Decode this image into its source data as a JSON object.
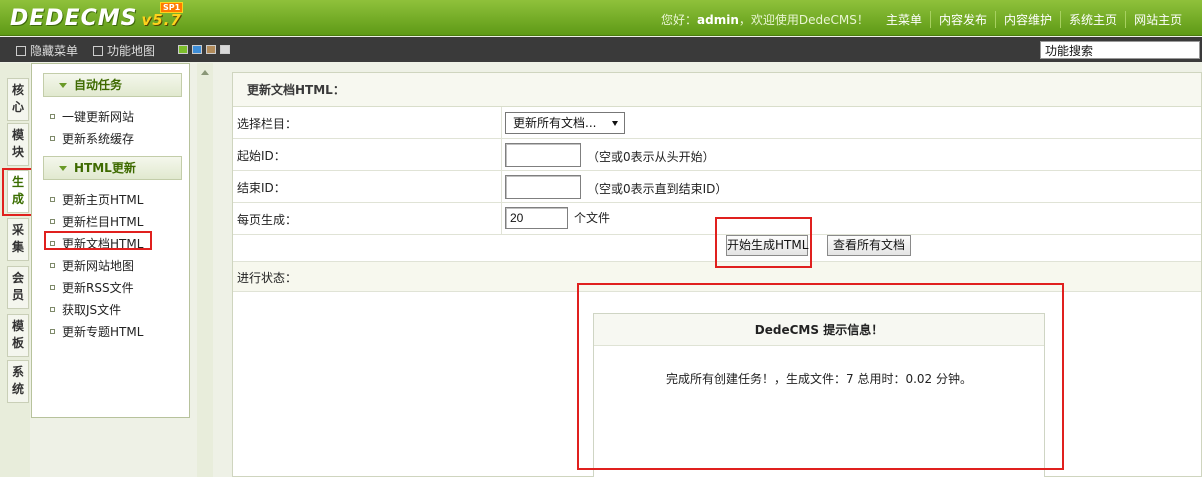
{
  "header": {
    "logo_text": "DEDECMS",
    "version": "v5.7",
    "sp_badge": "SP1",
    "welcome_prefix": "您好：",
    "username": "admin",
    "welcome_suffix": "，欢迎使用DedeCMS！",
    "nav": [
      "主菜单",
      "内容发布",
      "内容维护",
      "系统主页",
      "网站主页"
    ]
  },
  "toolbar": {
    "hide_menu": "隐藏菜单",
    "func_map": "功能地图",
    "search_value": "功能搜索",
    "swatches": [
      "#7cbd2b",
      "#3e8ed8",
      "#b08a5a",
      "#d8d8d8"
    ]
  },
  "vtabs": [
    {
      "label": "核心",
      "active": false
    },
    {
      "label": "模块",
      "active": false
    },
    {
      "label": "生成",
      "active": true
    },
    {
      "label": "采集",
      "active": false
    },
    {
      "label": "会员",
      "active": false
    },
    {
      "label": "模板",
      "active": false
    },
    {
      "label": "系统",
      "active": false
    }
  ],
  "sidebar": {
    "section1_title": "自动任务",
    "section1_items": [
      "一键更新网站",
      "更新系统缓存"
    ],
    "section2_title": "HTML更新",
    "section2_items": [
      "更新主页HTML",
      "更新栏目HTML",
      "更新文档HTML",
      "更新网站地图",
      "更新RSS文件",
      "获取JS文件",
      "更新专题HTML"
    ]
  },
  "main": {
    "title": "更新文档HTML：",
    "select_label": "选择栏目：",
    "select_value": "更新所有文档...",
    "start_id_label": "起始ID：",
    "start_id_value": "",
    "start_id_hint": "（空或0表示从头开始）",
    "end_id_label": "结束ID：",
    "end_id_value": "",
    "end_id_hint": "（空或0表示直到结束ID）",
    "per_page_label": "每页生成：",
    "per_page_value": "20",
    "per_page_unit": "个文件",
    "start_button": "开始生成HTML",
    "view_button": "查看所有文档",
    "status_label": "进行状态："
  },
  "message": {
    "title": "DedeCMS 提示信息！",
    "body": "完成所有创建任务！，生成文件：7 总用时：0.02 分钟。"
  },
  "colors": {
    "header_green": "#6fa922",
    "highlight_red": "#e0201e"
  }
}
